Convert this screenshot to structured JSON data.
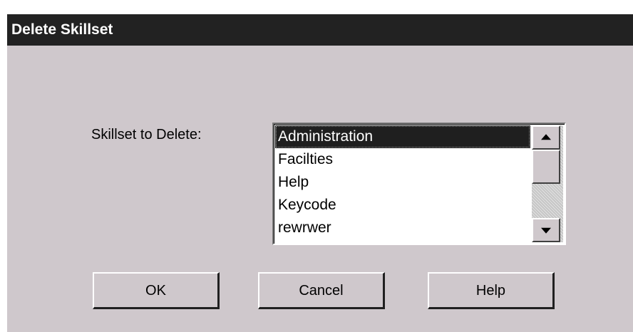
{
  "window": {
    "title": "Delete Skillset"
  },
  "form": {
    "label": "Skillset to Delete:",
    "items": [
      "Administration",
      "Facilties",
      "Help",
      "Keycode",
      "rewrwer"
    ],
    "selected": "Administration"
  },
  "buttons": {
    "ok": "OK",
    "cancel": "Cancel",
    "help": "Help"
  },
  "icons": {
    "scroll_up": "arrow-up-icon",
    "scroll_down": "arrow-down-icon"
  },
  "colors": {
    "dialog_bg": "#cfc8cc",
    "titlebar_bg": "#222222",
    "selection_bg": "#1f1f1f"
  }
}
